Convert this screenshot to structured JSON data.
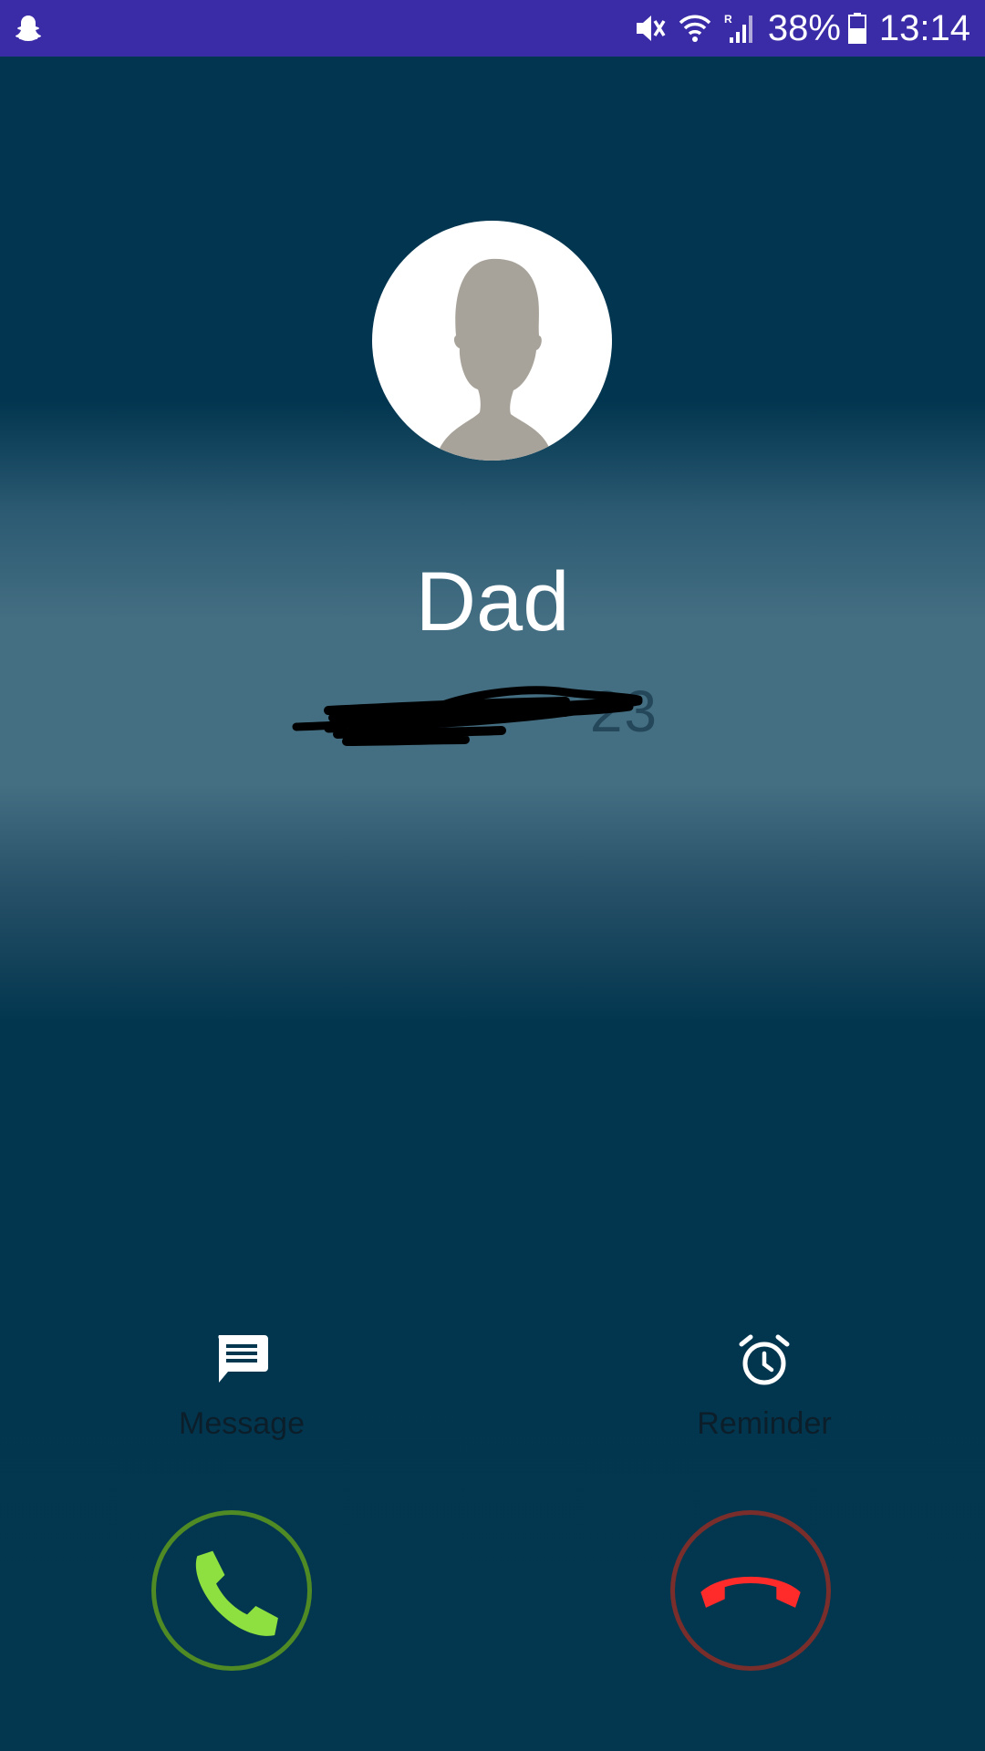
{
  "status_bar": {
    "left_icon": "snapchat-ghost-icon",
    "icons": [
      "mute-icon",
      "wifi-icon",
      "signal-icon",
      "battery-icon"
    ],
    "battery": "38%",
    "time": "13:14",
    "background": "#3a2ba6"
  },
  "caller": {
    "name": "Dad",
    "number_visible": "23",
    "avatar_icon": "person-silhouette-icon"
  },
  "quick_actions": {
    "message_label": "Message",
    "message_icon": "message-icon",
    "reminder_label": "Reminder",
    "reminder_icon": "alarm-clock-icon"
  },
  "call_buttons": {
    "answer_icon": "phone-icon",
    "answer_color": "#8ee040",
    "answer_ring_color": "#4f8a24",
    "decline_icon": "phone-hangup-icon",
    "decline_color": "#ff2b2b",
    "decline_ring_color": "#7a2e2b"
  }
}
